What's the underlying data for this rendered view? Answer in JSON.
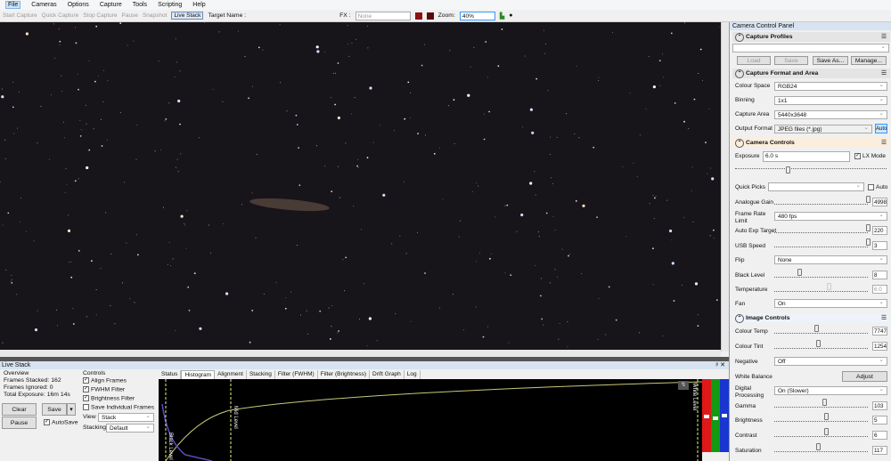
{
  "menu": [
    "File",
    "Cameras",
    "Options",
    "Capture",
    "Tools",
    "Scripting",
    "Help"
  ],
  "toolbar": {
    "start_capture": "Start Capture",
    "quick_capture": "Quick Capture",
    "stop_capture": "Stop Capture",
    "pause": "Pause",
    "snapshot": "Snapshot",
    "live_stack": "Live Stack",
    "target_name_label": "Target Name :",
    "fx_label": "FX :",
    "fx_value": "None",
    "zoom_label": "Zoom:",
    "zoom_value": "40%"
  },
  "live_stack": {
    "title": "Live Stack",
    "overview_label": "Overview",
    "frames_stacked_label": "Frames Stacked:",
    "frames_stacked": "162",
    "frames_ignored_label": "Frames Ignored:",
    "frames_ignored": "0",
    "total_exposure_label": "Total Exposure:",
    "total_exposure": "16m 14s",
    "clear": "Clear",
    "save": "Save",
    "pause": "Pause",
    "autosave": "AutoSave",
    "controls_label": "Controls",
    "align_frames": "Align Frames",
    "fwhm_filter": "FWHM Filter",
    "brightness_filter": "Brightness Filter",
    "save_individual": "Save Individual Frames",
    "view_label": "View",
    "view_value": "Stack",
    "stacking_label": "Stacking",
    "stacking_value": "Default",
    "tabs": [
      "Status",
      "Histogram",
      "Alignment",
      "Stacking",
      "Filter (FWHM)",
      "Filter (Brightness)",
      "Drift Graph",
      "Log"
    ],
    "black_level": "Black Level",
    "mid_level": "Mid Level",
    "white_level": "White Level"
  },
  "panel": {
    "title": "Camera Control Panel",
    "capture_profiles": "Capture Profiles",
    "load": "Load",
    "save": "Save",
    "save_as": "Save As...",
    "manage": "Manage...",
    "capture_format": "Capture Format and Area",
    "colour_space_label": "Colour Space",
    "colour_space": "RGB24",
    "binning_label": "Binning",
    "binning": "1x1",
    "capture_area_label": "Capture Area",
    "capture_area": "5440x3648",
    "output_format_label": "Output Format",
    "output_format": "JPEG files (*.jpg)",
    "auto": "Auto",
    "camera_controls": "Camera Controls",
    "exposure_label": "Exposure",
    "exposure": "6.0 s",
    "lx_mode": "LX Mode",
    "quick_picks_label": "Quick Picks",
    "quick_auto": "Auto",
    "analogue_gain_label": "Analogue Gain",
    "analogue_gain": "4998",
    "frame_rate_label": "Frame Rate Limit",
    "frame_rate": "480 fps",
    "auto_exp_label": "Auto Exp Target",
    "auto_exp": "220",
    "usb_speed_label": "USB Speed",
    "usb_speed": "3",
    "flip_label": "Flip",
    "flip": "None",
    "black_level_label": "Black Level",
    "black_level": "8",
    "temperature_label": "Temperature",
    "temperature": "6.0",
    "fan_label": "Fan",
    "fan": "On",
    "image_controls": "Image Controls",
    "colour_temp_label": "Colour Temp",
    "colour_temp": "7747",
    "colour_tint_label": "Colour Tint",
    "colour_tint": "1254",
    "negative_label": "Negative",
    "negative": "Off",
    "white_balance_label": "White Balance",
    "adjust": "Adjust",
    "digital_processing_label": "Digital Processing",
    "digital_processing": "On (Slower)",
    "gamma_label": "Gamma",
    "gamma": "103",
    "brightness_label": "Brightness",
    "brightness": "5",
    "contrast_label": "Contrast",
    "contrast": "6",
    "saturation_label": "Saturation",
    "saturation": "117"
  },
  "colors": {
    "accent": "#3399ff",
    "sky": "#17141a"
  }
}
